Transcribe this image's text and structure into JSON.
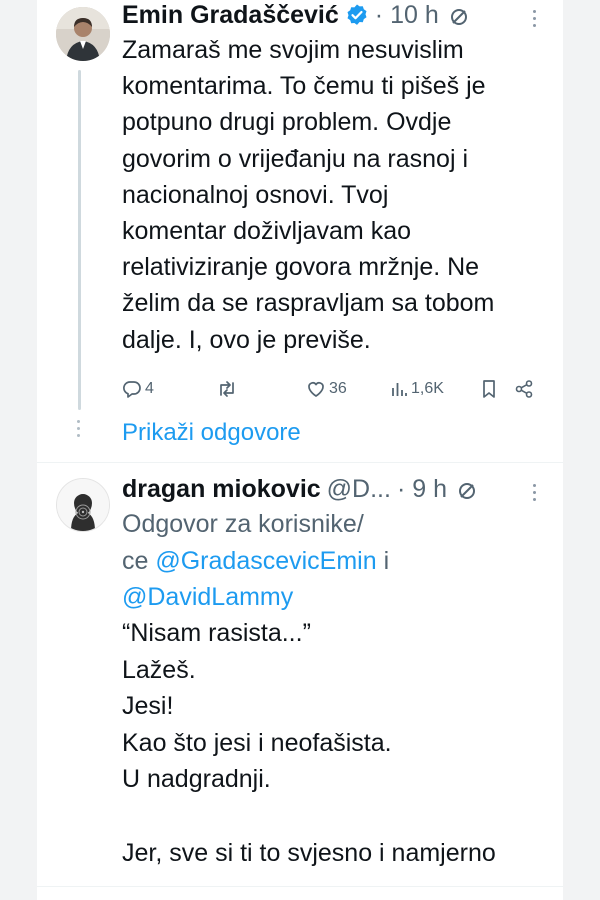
{
  "colors": {
    "accent": "#1d9bf0",
    "text": "#0f1419",
    "muted": "#536471"
  },
  "tweet1": {
    "name": "Emin Gradaščević",
    "time": "· 10 h",
    "text_lines": [
      "Zamaraš me svojim nesuvislim",
      "komentarima. To čemu ti pišeš je",
      "potpuno drugi problem. Ovdje",
      "govorim o vrijeđanju na rasnoj i",
      "nacionalnoj osnovi. Tvoj",
      "komentar doživljavam kao",
      "relativiziranje govora mržnje. Ne",
      "želim da se raspravljam sa tobom",
      "dalje. I, ovo je previše."
    ],
    "actions": {
      "replies": "4",
      "likes": "36",
      "views": "1,6K"
    }
  },
  "show_replies": "Prikaži odgovore",
  "tweet2": {
    "name": "dragan miokovic",
    "handle": "@D...",
    "time": "· 9 h",
    "reply_prefix": "Odgovor za korisnike/",
    "reply_line2_prefix": "ce ",
    "mention1": "@GradascevicEmin",
    "reply_and": " i",
    "mention2": "@DavidLammy",
    "text_lines": [
      "“Nisam rasista...”",
      "Lažeš.",
      "Jesi!",
      "Kao što jesi i neofašista.",
      "U nadgradnji."
    ],
    "last_line": "Jer, sve si ti to svjesno i namjerno"
  }
}
